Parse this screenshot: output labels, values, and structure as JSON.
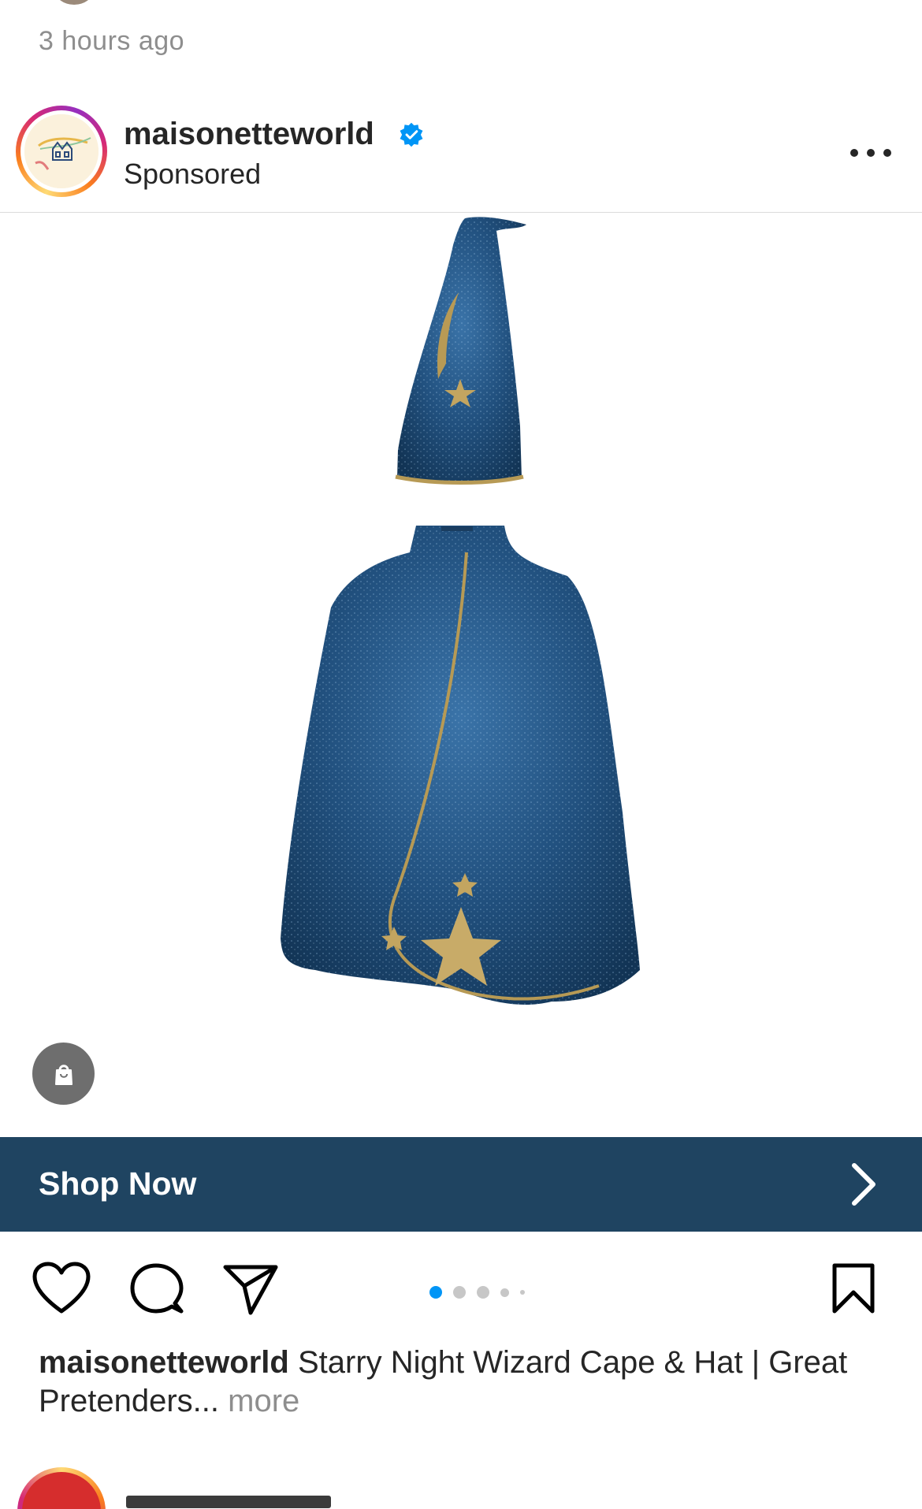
{
  "previous_post": {
    "timestamp": "3 hours ago"
  },
  "post": {
    "username": "maisonetteworld",
    "verified": true,
    "verified_icon": "verified-badge-icon",
    "subtitle": "Sponsored",
    "more_icon": "more-options-icon",
    "media": {
      "description_icon": "wizard-cape-and-hat-product-image",
      "shopping_icon": "shopping-bag-icon"
    },
    "cta": {
      "label": "Shop Now",
      "icon": "chevron-right-icon",
      "background": "#1f4461"
    },
    "actions": {
      "like_icon": "heart-icon",
      "comment_icon": "comment-icon",
      "share_icon": "paper-plane-icon",
      "save_icon": "bookmark-icon"
    },
    "carousel": {
      "total_visible_dots": 5,
      "active_index": 0,
      "active_color": "#0095f6",
      "inactive_color": "#c7c7c7"
    },
    "caption": {
      "username": "maisonetteworld",
      "text": " Starry Night Wizard Cape & Hat | Great Pretenders...",
      "more_label": " more"
    }
  }
}
